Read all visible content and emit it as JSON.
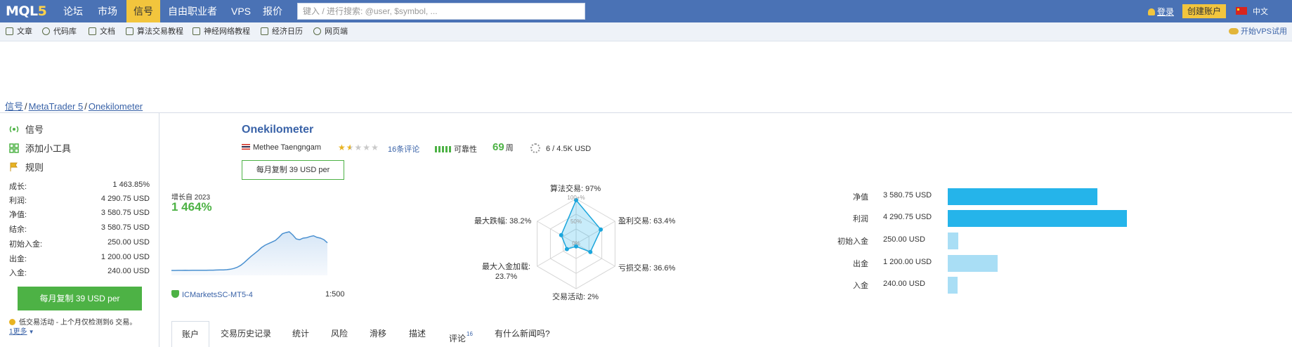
{
  "topbar": {
    "logo_main": "MQL",
    "logo_num": "5",
    "nav": [
      "论坛",
      "市场",
      "信号",
      "自由职业者",
      "VPS",
      "报价"
    ],
    "active_index": 2,
    "search_placeholder": "键入 / 进行搜索: @user, $symbol, ...",
    "login": "登录",
    "create": "创建账户",
    "lang": "中文"
  },
  "subnav": {
    "items": [
      "文章",
      "代码库",
      "文档",
      "算法交易教程",
      "神经网络教程",
      "经济日历",
      "网页端"
    ],
    "vps": "开始VPS试用"
  },
  "breadcrumb": {
    "a": "信号",
    "b": "MetaTrader 5",
    "c": "Onekilometer"
  },
  "sidebar": {
    "links": [
      "信号",
      "添加小工具",
      "规则"
    ],
    "stats": [
      {
        "label": "成长:",
        "value": "1 463.85%"
      },
      {
        "label": "利润:",
        "value": "4 290.75 USD"
      },
      {
        "label": "净值:",
        "value": "3 580.75 USD"
      },
      {
        "label": "结余:",
        "value": "3 580.75 USD"
      },
      {
        "label": "初始入金:",
        "value": "250.00 USD"
      },
      {
        "label": "出金:",
        "value": "1 200.00 USD"
      },
      {
        "label": "入金:",
        "value": "240.00 USD"
      }
    ],
    "copy_button": "每月复制 39 USD per",
    "note": "低交易活动 - 上个月仅检测到6 交易。",
    "note_more": "1更多"
  },
  "header": {
    "title": "Onekilometer",
    "author": "Methee Taengngam",
    "rating": 1.5,
    "reviews": "16条评论",
    "reliability": "可靠性",
    "weeks": "69",
    "weeks_unit": "周",
    "subscribers": "6 / 4.5K USD",
    "copy_box": "每月复制 39 USD per"
  },
  "growth": {
    "since": "增长自 2023",
    "value": "1 464%",
    "series": [
      2,
      2,
      2.1,
      2.2,
      2.3,
      2.2,
      2.4,
      2.5,
      2.4,
      2.6,
      2.5,
      2.7,
      2.8,
      3,
      3.2,
      3.5,
      4,
      5,
      7,
      10,
      15,
      22,
      30,
      38,
      45,
      52,
      60,
      66,
      70,
      74,
      78,
      86,
      95,
      98,
      100,
      92,
      82,
      80,
      84,
      85,
      88,
      90,
      86,
      84,
      80,
      72
    ],
    "broker": "ICMarketsSC-MT5-4",
    "leverage": "1:500"
  },
  "radar": {
    "axes": [
      {
        "label": "算法交易: 97%",
        "value": 97
      },
      {
        "label": "盈利交易: 63.4%",
        "value": 63.4
      },
      {
        "label": "亏损交易: 36.6%",
        "value": 36.6
      },
      {
        "label": "交易活动: 2%",
        "value": 2
      },
      {
        "label": "最大入金加载:",
        "label2": "23.7%",
        "value": 23.7
      },
      {
        "label": "最大跌幅: 38.2%",
        "value": 38.2
      }
    ],
    "tick_100": "100+%",
    "tick_50": "50%",
    "tick_0": "0%"
  },
  "hbars": {
    "max": 4290.75,
    "items": [
      {
        "label": "净值",
        "value_text": "3 580.75 USD",
        "value": 3580.75,
        "color": "#25b4ea"
      },
      {
        "label": "利润",
        "value_text": "4 290.75 USD",
        "value": 4290.75,
        "color": "#25b4ea"
      },
      {
        "label": "初始入金",
        "value_text": "250.00 USD",
        "value": 250,
        "color": "#a9def5"
      },
      {
        "label": "出金",
        "value_text": "1 200.00 USD",
        "value": 1200,
        "color": "#a9def5"
      },
      {
        "label": "入金",
        "value_text": "240.00 USD",
        "value": 240,
        "color": "#a9def5"
      }
    ]
  },
  "tabs": {
    "items": [
      "账户",
      "交易历史记录",
      "统计",
      "风险",
      "滑移",
      "描述",
      "评论",
      "有什么新闻吗?"
    ],
    "review_count": "16",
    "active_index": 0
  }
}
